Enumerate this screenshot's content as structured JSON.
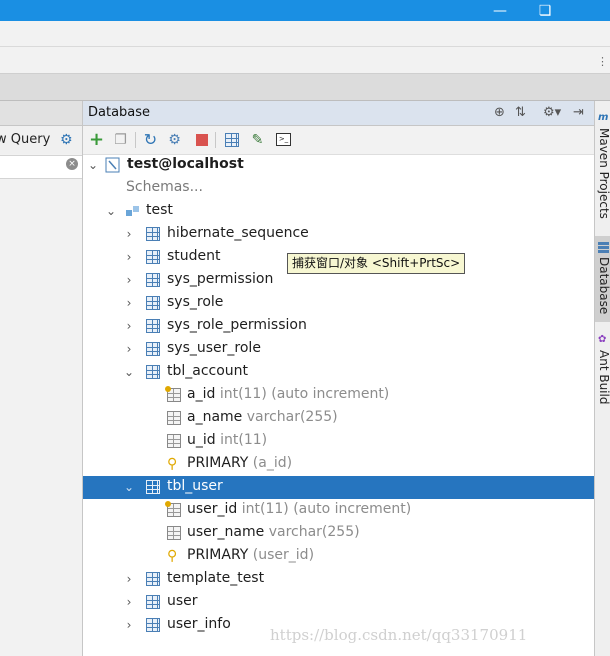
{
  "window": {
    "min_icon": "minimize-icon",
    "max_icon": "restore-icon"
  },
  "left_panel": {
    "query_button_label": "w Query",
    "search_value": ""
  },
  "database_panel": {
    "title": "Database",
    "header_icons": [
      "target-icon",
      "collapse-icon",
      "gear-icon",
      "hide-icon"
    ],
    "toolbar_icons": [
      "add-icon",
      "copy-icon",
      "refresh-icon",
      "filter-icon",
      "stop-icon",
      "table-view-icon",
      "edit-icon",
      "console-icon"
    ]
  },
  "tree": {
    "connection": "test@localhost",
    "schemas_link": "Schemas...",
    "schema": "test",
    "tables_before": [
      "hibernate_sequence",
      "student",
      "sys_permission",
      "sys_role",
      "sys_role_permission",
      "sys_user_role"
    ],
    "tbl_account": {
      "name": "tbl_account",
      "columns": [
        {
          "name": "a_id",
          "type": "int(11) (auto increment)",
          "icon": "key-column-icon"
        },
        {
          "name": "a_name",
          "type": "varchar(255)",
          "icon": "column-icon"
        },
        {
          "name": "u_id",
          "type": "int(11)",
          "icon": "column-icon"
        }
      ],
      "key": {
        "name": "PRIMARY",
        "detail": "(a_id)"
      }
    },
    "tbl_user": {
      "name": "tbl_user",
      "columns": [
        {
          "name": "user_id",
          "type": "int(11) (auto increment)",
          "icon": "key-column-icon"
        },
        {
          "name": "user_name",
          "type": "varchar(255)",
          "icon": "column-icon"
        }
      ],
      "key": {
        "name": "PRIMARY",
        "detail": "(user_id)"
      }
    },
    "tables_after": [
      "template_test",
      "user",
      "user_info"
    ]
  },
  "tooltip": "捕获窗口/对象 <Shift+PrtSc>",
  "right_sidebar": {
    "tabs": [
      "Maven Projects",
      "Database",
      "Ant Build"
    ],
    "active": "Database"
  },
  "watermark": "https://blog.csdn.net/qq33170911",
  "colors": {
    "titlebar": "#1a8fe3",
    "selection": "#2675bf",
    "tooltip_bg": "#f7f7d2"
  }
}
